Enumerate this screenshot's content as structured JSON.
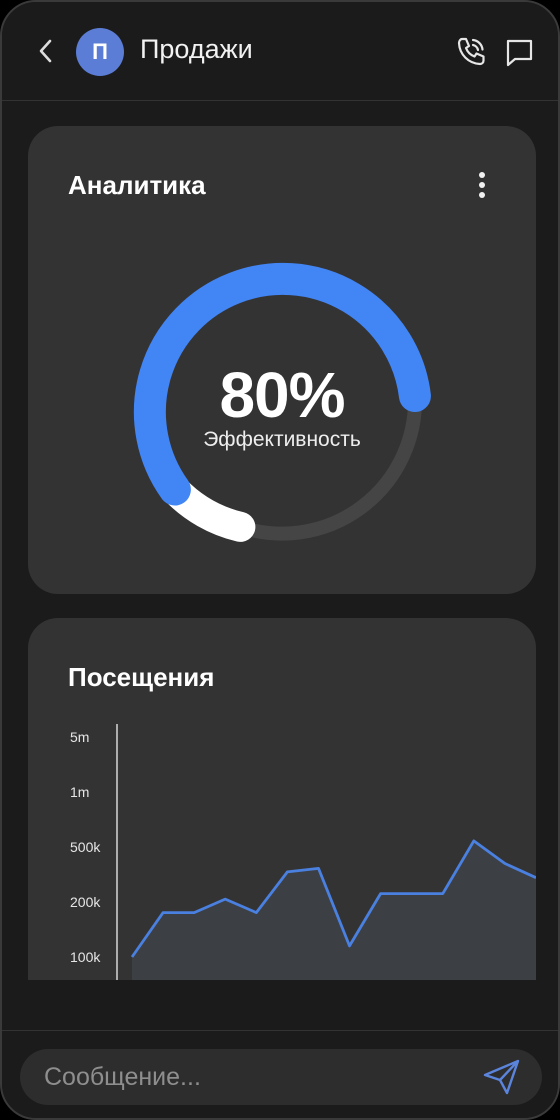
{
  "header": {
    "avatar_letter": "П",
    "title": "Продажи",
    "icons": [
      "back-icon",
      "phone-call-icon",
      "chat-bubble-icon"
    ]
  },
  "analytics": {
    "title": "Аналитика",
    "percent_label": "80%",
    "percent_value": 0.8,
    "caption": "Эффективность",
    "colors": {
      "primary": "#4285f4",
      "secondary": "#ffffff",
      "track": "#454545"
    }
  },
  "visits": {
    "title": "Посещения"
  },
  "chart_data": {
    "type": "area",
    "title": "Посещения",
    "y_scale": "log",
    "y_ticks": [
      "5m",
      "1m",
      "500k",
      "200k",
      "100k"
    ],
    "y_tick_values": [
      5000000,
      1000000,
      500000,
      200000,
      100000
    ],
    "ylim": [
      100000,
      5000000
    ],
    "x": [
      1,
      2,
      3,
      4,
      5,
      6,
      7,
      8,
      9,
      10,
      11,
      12,
      13,
      14
    ],
    "series": [
      {
        "values": [
          100000,
          175000,
          175000,
          210000,
          175000,
          330000,
          350000,
          115000,
          230000,
          230000,
          230000,
          540000,
          380000,
          300000
        ]
      }
    ],
    "line_color": "#4a80e0",
    "grid": false
  },
  "composer": {
    "placeholder": "Сообщение...",
    "send_icon": "send-icon"
  }
}
